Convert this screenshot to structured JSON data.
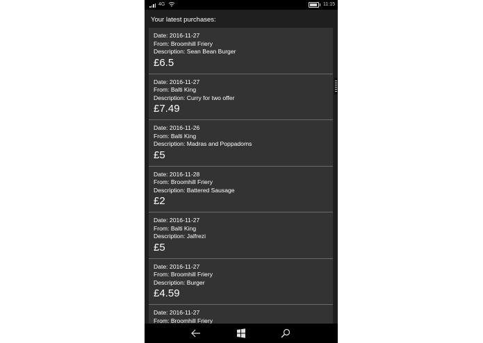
{
  "status_bar": {
    "network": "4G",
    "time": "11:15"
  },
  "header": {
    "title": "Your latest purchases:"
  },
  "purchases": [
    {
      "date": "Date: 2016-11-27",
      "from": "From: Broomhill Friery",
      "description": "Description: Sean Bean Burger",
      "price": "£6.5"
    },
    {
      "date": "Date: 2016-11-27",
      "from": "From: Balti King",
      "description": "Description: Curry for two offer",
      "price": "£7.49"
    },
    {
      "date": "Date: 2016-11-26",
      "from": "From: Balti King",
      "description": "Description: Madras and Poppadoms",
      "price": "£5"
    },
    {
      "date": "Date: 2016-11-28",
      "from": "From: Broomhill Friery",
      "description": "Description: Battered Sausage",
      "price": "£2"
    },
    {
      "date": "Date: 2016-11-27",
      "from": "From: Balti King",
      "description": "Description: Jalfrezi",
      "price": "£5"
    },
    {
      "date": "Date: 2016-11-27",
      "from": "From: Broomhill Friery",
      "description": "Description: Burger",
      "price": "£4.59"
    },
    {
      "date": "Date: 2016-11-27",
      "from": "From: Broomhill Friery",
      "description": "",
      "price": ""
    }
  ],
  "nav": {
    "back_icon": "back-arrow-icon",
    "home_icon": "windows-logo-icon",
    "search_icon": "search-icon"
  }
}
